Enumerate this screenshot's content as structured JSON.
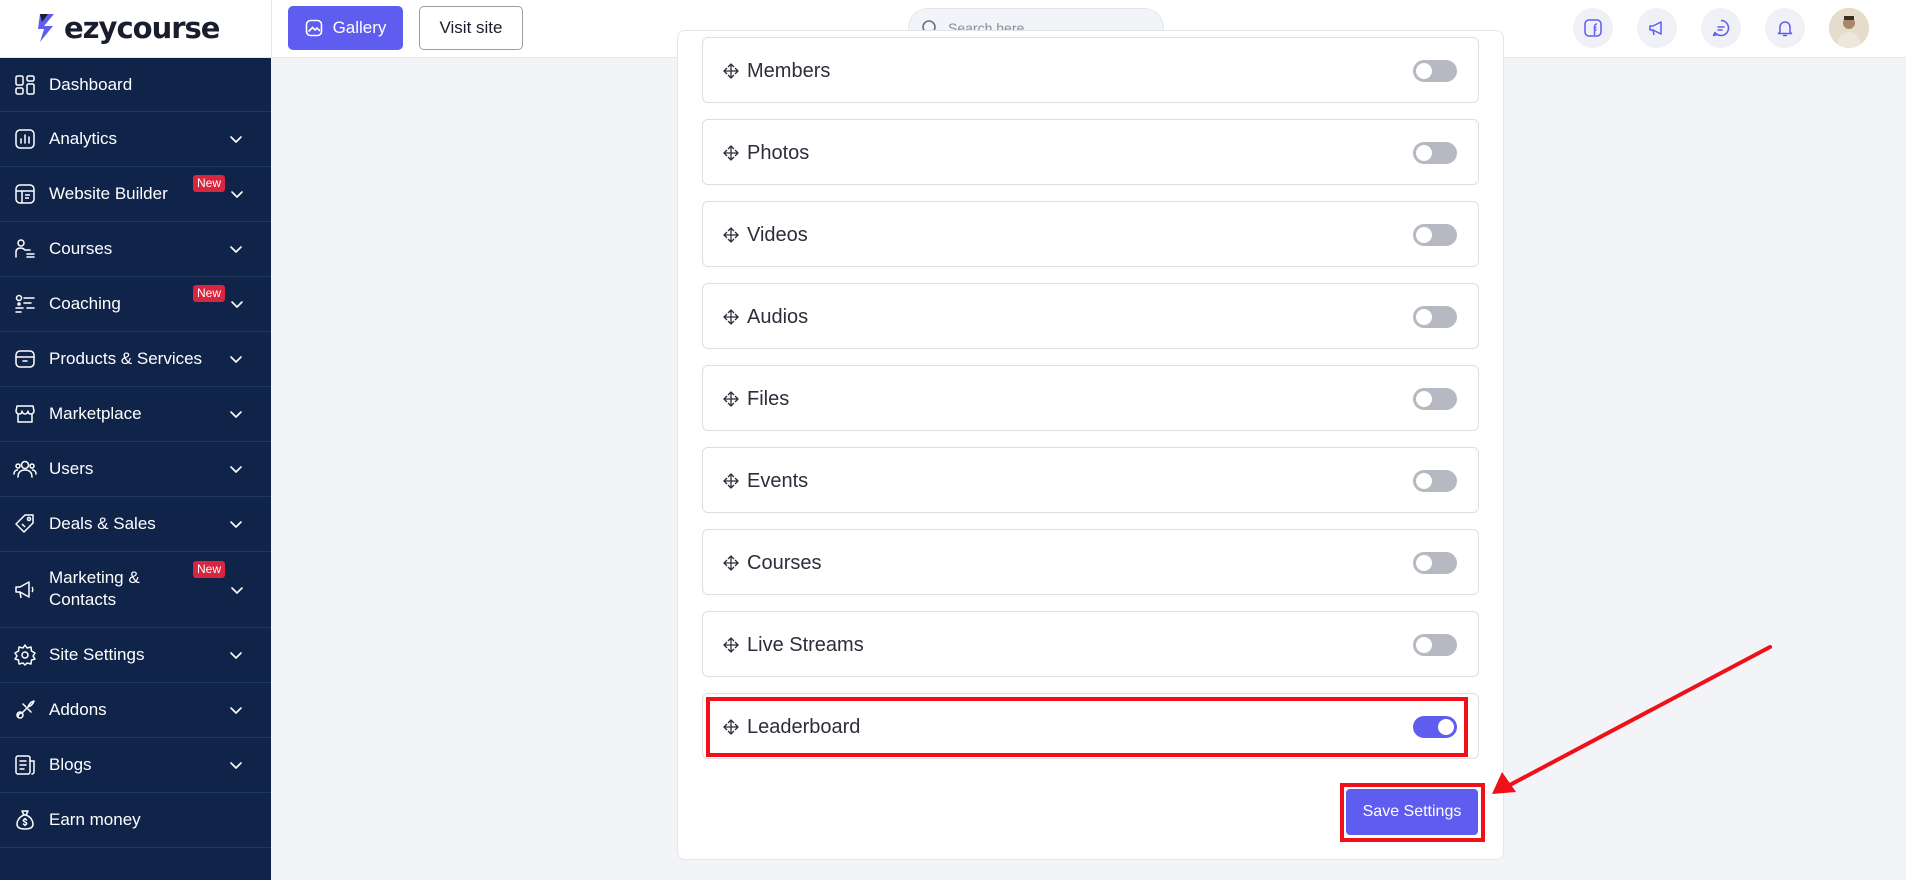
{
  "app": {
    "logo_text": "ezycourse",
    "gallery_label": "Gallery",
    "visit_site_label": "Visit site",
    "search_placeholder": "Search here"
  },
  "sidebar": {
    "items": [
      {
        "label": "Dashboard",
        "icon": "dashboard-icon",
        "chevron": false,
        "badge": ""
      },
      {
        "label": "Analytics",
        "icon": "analytics-icon",
        "chevron": true,
        "badge": ""
      },
      {
        "label": "Website Builder",
        "icon": "website-builder-icon",
        "chevron": true,
        "badge": "New"
      },
      {
        "label": "Courses",
        "icon": "courses-icon",
        "chevron": true,
        "badge": ""
      },
      {
        "label": "Coaching",
        "icon": "coaching-icon",
        "chevron": true,
        "badge": "New"
      },
      {
        "label": "Products & Services",
        "icon": "products-icon",
        "chevron": true,
        "badge": ""
      },
      {
        "label": "Marketplace",
        "icon": "marketplace-icon",
        "chevron": true,
        "badge": ""
      },
      {
        "label": "Users",
        "icon": "users-icon",
        "chevron": true,
        "badge": ""
      },
      {
        "label": "Deals & Sales",
        "icon": "deals-icon",
        "chevron": true,
        "badge": ""
      },
      {
        "label": "Marketing & Contacts",
        "label_line1": "Marketing &",
        "label_line2": "Contacts",
        "icon": "marketing-icon",
        "chevron": true,
        "badge": "New"
      },
      {
        "label": "Site Settings",
        "icon": "site-settings-icon",
        "chevron": true,
        "badge": ""
      },
      {
        "label": "Addons",
        "icon": "addons-icon",
        "chevron": true,
        "badge": ""
      },
      {
        "label": "Blogs",
        "icon": "blogs-icon",
        "chevron": true,
        "badge": ""
      },
      {
        "label": "Earn money",
        "icon": "earn-money-icon",
        "chevron": false,
        "badge": ""
      }
    ]
  },
  "settings": {
    "rows": [
      {
        "label": "Members",
        "enabled": false
      },
      {
        "label": "Photos",
        "enabled": false
      },
      {
        "label": "Videos",
        "enabled": false
      },
      {
        "label": "Audios",
        "enabled": false
      },
      {
        "label": "Files",
        "enabled": false
      },
      {
        "label": "Events",
        "enabled": false
      },
      {
        "label": "Courses",
        "enabled": false
      },
      {
        "label": "Live Streams",
        "enabled": false
      },
      {
        "label": "Leaderboard",
        "enabled": true
      }
    ],
    "save_label": "Save Settings"
  },
  "colors": {
    "accent": "#5f5cf0",
    "sidebar_bg": "#10244a",
    "badge_new": "#d7263d",
    "highlight": "#f0101a"
  }
}
